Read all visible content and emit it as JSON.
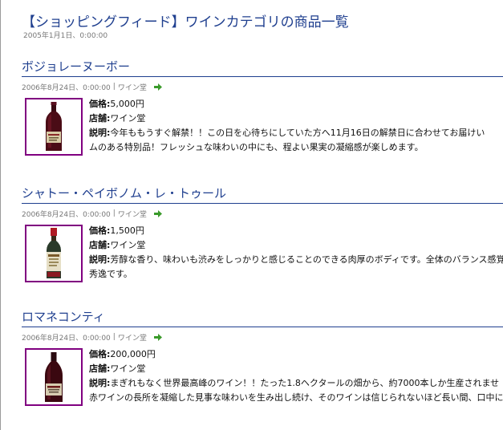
{
  "page": {
    "title": "【ショッピングフィード】ワインカテゴリの商品一覧",
    "date": "2005年1月1日、0:00:00"
  },
  "entries": [
    {
      "title": "ボジョレーヌーボー",
      "meta_date": "2006年8月24日、0:00:00",
      "meta_sep": "|",
      "meta_shop": "ワイン堂",
      "price_label": "価格:",
      "price": "5,000円",
      "shop_label": "店舗:",
      "shop": "ワイン堂",
      "desc_label": "説明:",
      "desc_line1": "今年ももうすぐ解禁！！この日を心待ちにしていた方へ11月16日の解禁日に合わせてお届けい",
      "desc_line2": "ムのある特別品！フレッシュな味わいの中にも、程よい果実の凝縮感が楽しめます。",
      "bottle_icon": "red-wine-bottle-icon"
    },
    {
      "title": "シャトー・ペイボノム・レ・トゥール",
      "meta_date": "2006年8月24日、0:00:00",
      "meta_sep": "|",
      "meta_shop": "ワイン堂",
      "price_label": "価格:",
      "price": "1,500円",
      "shop_label": "店舗:",
      "shop": "ワイン堂",
      "desc_label": "説明:",
      "desc_line1": "芳醇な香り、味わいも渋みをしっかりと感じることのできる肉厚のボディです。全体のバランス感覚",
      "desc_line2": "秀逸です。",
      "bottle_icon": "half-bottle-wine-icon"
    },
    {
      "title": "ロマネコンティ",
      "meta_date": "2006年8月24日、0:00:00",
      "meta_sep": "|",
      "meta_shop": "ワイン堂",
      "price_label": "価格:",
      "price": "200,000円",
      "shop_label": "店舗:",
      "shop": "ワイン堂",
      "desc_label": "説明:",
      "desc_line1": "まぎれもなく世界最高峰のワイン！！たった1.8ヘクタールの畑から、約7000本しか生産されませ",
      "desc_line2": "赤ワインの長所を凝縮した見事な味わいを生み出し続け、そのワインは信じられないほど長い間、口中に",
      "bottle_icon": "burgundy-bottle-icon"
    }
  ],
  "colors": {
    "title": "#1f3f8f",
    "meta": "#777777",
    "thumb_border": "#800080",
    "arrow": "#3a9a2a"
  },
  "icons": {
    "arrow": "green-right-arrow-icon"
  }
}
